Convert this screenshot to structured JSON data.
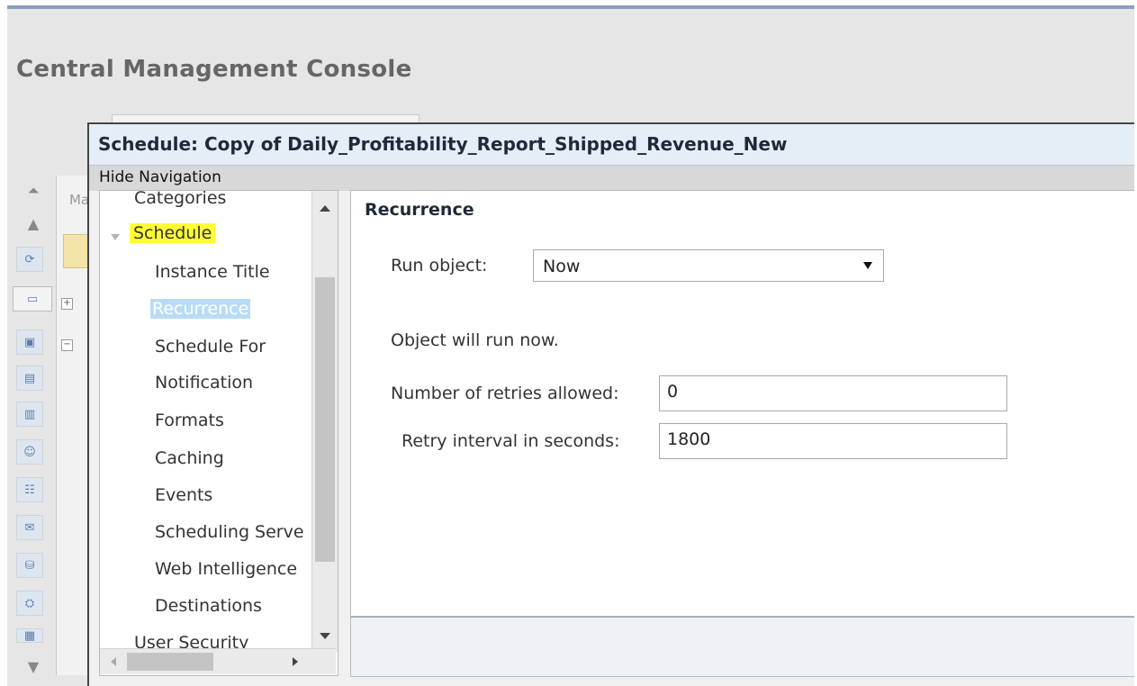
{
  "app": {
    "title": "Central Management Console"
  },
  "background": {
    "tab_label_fragment": "Ma"
  },
  "dialog": {
    "title": "Schedule: Copy of Daily_Profitability_Report_Shipped_Revenue_New",
    "hide_navigation": "Hide Navigation"
  },
  "nav": {
    "items": [
      {
        "label": "Categories"
      },
      {
        "label": "Schedule"
      },
      {
        "label": "Instance Title"
      },
      {
        "label": "Recurrence"
      },
      {
        "label": "Schedule For"
      },
      {
        "label": "Notification"
      },
      {
        "label": "Formats"
      },
      {
        "label": "Caching"
      },
      {
        "label": "Events"
      },
      {
        "label": "Scheduling Serve"
      },
      {
        "label": "Web Intelligence"
      },
      {
        "label": "Destinations"
      },
      {
        "label": "User Security"
      }
    ],
    "selected": "Recurrence",
    "highlighted": "Schedule"
  },
  "content": {
    "section_title": "Recurrence",
    "run_object_label": "Run object:",
    "run_object_value": "Now",
    "info_text": "Object will run now.",
    "retries_label": "Number of retries allowed:",
    "retries_value": "0",
    "interval_label": "Retry interval in seconds:",
    "interval_value": "1800"
  },
  "colors": {
    "highlight": "#ffff36",
    "selection": "#b8dcf6",
    "title_bar": "#e5edf7"
  }
}
